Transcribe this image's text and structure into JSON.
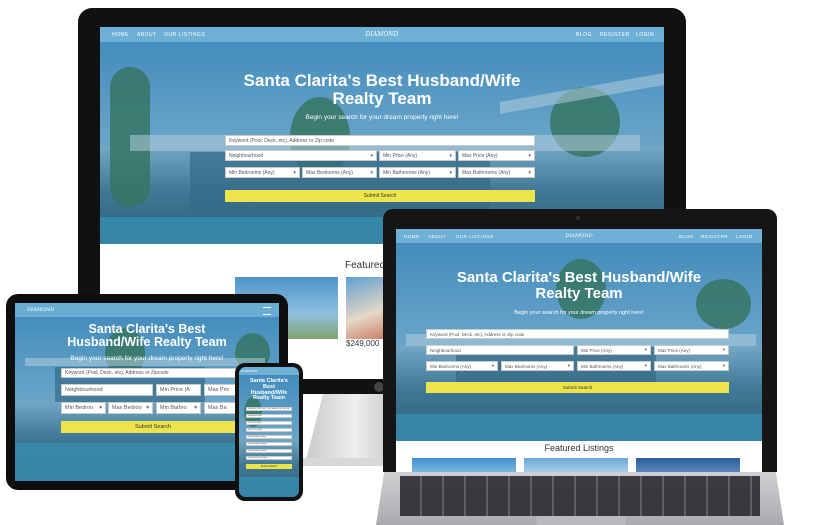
{
  "nav": {
    "home": "HOME",
    "about": "ABOUT",
    "our_listings": "OUR LISTINGS",
    "blog": "BLOG",
    "register": "REGISTER",
    "login": "LOGIN",
    "logo": "DIAMOND"
  },
  "hero": {
    "title_line1": "Santa Clarita's Best Husband/Wife",
    "title_line2": "Realty Team",
    "title_tablet_line1": "Santa Clarita's Best",
    "title_tablet_line2": "Husband/Wife Realty Team",
    "title_phone_line1": "Santa Clarita's",
    "title_phone_line2": "Best",
    "title_phone_line3": "Husband/Wife",
    "title_phone_line4": "Realty Team",
    "subtitle": "Begin your search for your dream property right here!"
  },
  "search": {
    "keyword_placeholder": "Keyword (Pool, Deck, etc), Address or Zipcode",
    "keyword_placeholder_short": "Keyword (Pool, Deck, etc), Address or Zip code",
    "neighbourhood": "Neighbourhood",
    "min_price": "Min Price (Any)",
    "max_price": "Max Price (Any)",
    "min_bedrooms": "Min Bedrooms (Any)",
    "max_bedrooms": "Max Bedrooms (Any)",
    "min_bathrooms": "Min Bathrooms (Any)",
    "max_bathrooms": "Max Bathrooms (Any)",
    "tablet_min_price": "Min Price (A",
    "tablet_max_price": "Max Pric",
    "tablet_min_bed": "Min Bedroo",
    "tablet_max_bed": "Max Bedroo",
    "tablet_min_bath": "Min Bathro",
    "tablet_max_bath": "Max Ba",
    "submit": "Submit Search"
  },
  "featured": {
    "heading": "Featured Listings",
    "heading_partial": "Featured",
    "price_partial": "$249,000"
  },
  "colors": {
    "nav": "#6fb0d6",
    "button": "#ede34a"
  }
}
